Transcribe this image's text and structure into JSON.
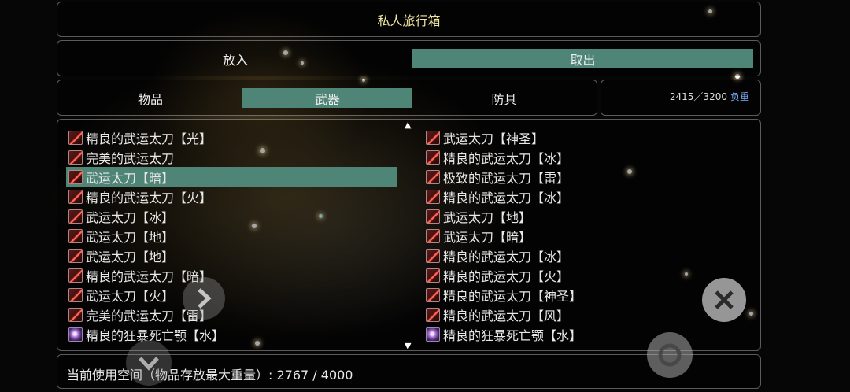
{
  "title": "私人旅行箱",
  "actions": {
    "put": "放入",
    "take": "取出"
  },
  "tabs": {
    "items": "物品",
    "weapons": "武器",
    "armor": "防具"
  },
  "weight": {
    "value": "2415／3200",
    "label": "负重"
  },
  "left_items": [
    {
      "name": "精良的武运太刀【光】",
      "icon": "blade-icon"
    },
    {
      "name": "完美的武运太刀",
      "icon": "blade-icon"
    },
    {
      "name": "武运太刀【暗】",
      "icon": "blade-icon",
      "selected": true
    },
    {
      "name": "精良的武运太刀【火】",
      "icon": "blade-icon"
    },
    {
      "name": "武运太刀【冰】",
      "icon": "blade-icon"
    },
    {
      "name": "武运太刀【地】",
      "icon": "blade-icon"
    },
    {
      "name": "武运太刀【地】",
      "icon": "blade-icon"
    },
    {
      "name": "精良的武运太刀【暗】",
      "icon": "blade-icon"
    },
    {
      "name": "武运太刀【火】",
      "icon": "blade-icon"
    },
    {
      "name": "完美的武运太刀【雷】",
      "icon": "blade-icon"
    },
    {
      "name": "精良的狂暴死亡颚【水】",
      "icon": "orb-icon"
    }
  ],
  "right_items": [
    {
      "name": "武运太刀【神圣】",
      "icon": "blade-icon"
    },
    {
      "name": "精良的武运太刀【冰】",
      "icon": "blade-icon"
    },
    {
      "name": "极致的武运太刀【雷】",
      "icon": "blade-icon"
    },
    {
      "name": "精良的武运太刀【冰】",
      "icon": "blade-icon"
    },
    {
      "name": "武运太刀【地】",
      "icon": "blade-icon"
    },
    {
      "name": "武运太刀【暗】",
      "icon": "blade-icon"
    },
    {
      "name": "精良的武运太刀【冰】",
      "icon": "blade-icon"
    },
    {
      "name": "精良的武运太刀【火】",
      "icon": "blade-icon"
    },
    {
      "name": "精良的武运太刀【神圣】",
      "icon": "blade-icon"
    },
    {
      "name": "精良的武运太刀【风】",
      "icon": "blade-icon"
    },
    {
      "name": "精良的狂暴死亡颚【水】",
      "icon": "orb-icon"
    }
  ],
  "footer": {
    "text": "当前使用空间（物品存放最大重量）: 2767 / 4000"
  },
  "controls": {
    "left": "chevron-left-icon",
    "down": "chevron-down-icon",
    "close": "close-icon",
    "confirm": "ring-icon"
  },
  "colors": {
    "active": "#4f8577",
    "title_text": "#f0e6a0",
    "weight_label": "#7fb0ff"
  }
}
